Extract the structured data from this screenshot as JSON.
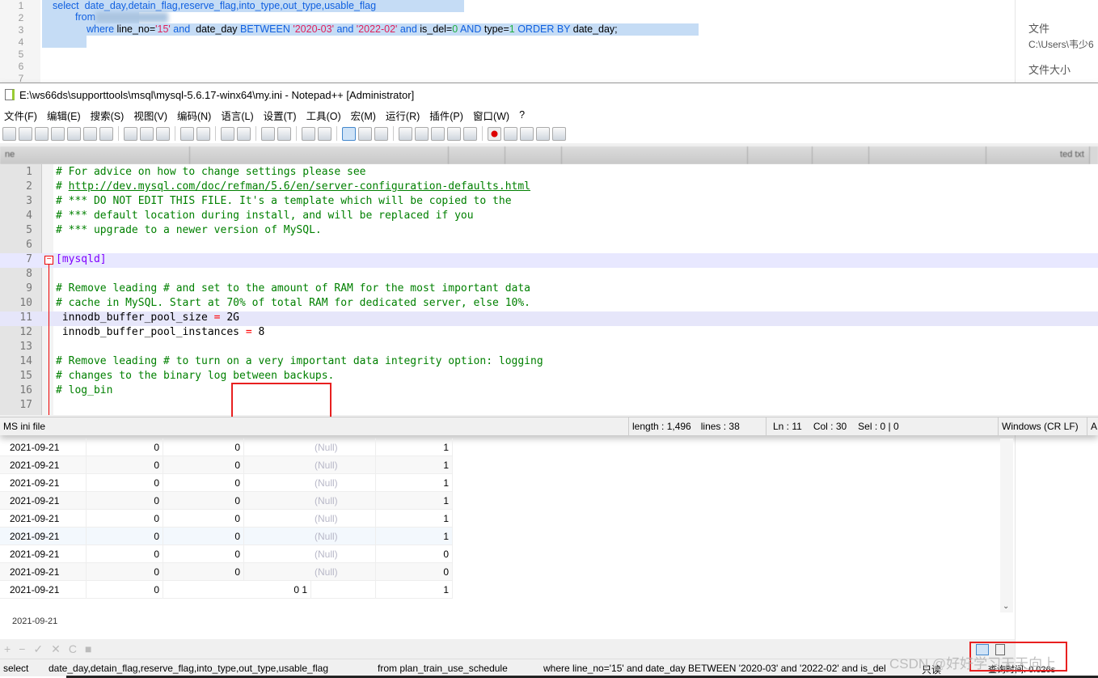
{
  "sql_editor": {
    "lines": [
      "1",
      "2",
      "3",
      "4",
      "5",
      "6",
      "7"
    ],
    "line1": "select  date_day,detain_flag,reserve_flag,into_type,out_type,usable_flag",
    "line2_kw": "from",
    "line3": [
      {
        "t": "where",
        "c": "kw"
      },
      {
        "t": " line_no=",
        "c": ""
      },
      {
        "t": "'15'",
        "c": "str"
      },
      {
        "t": " and ",
        "c": "kw"
      },
      {
        "t": " date_day ",
        "c": ""
      },
      {
        "t": "BETWEEN",
        "c": "kw"
      },
      {
        "t": " ",
        "c": ""
      },
      {
        "t": "'2020-03'",
        "c": "str"
      },
      {
        "t": " and ",
        "c": "kw"
      },
      {
        "t": "'2022-02'",
        "c": "str"
      },
      {
        "t": " and ",
        "c": "kw"
      },
      {
        "t": "is_del=",
        "c": ""
      },
      {
        "t": "0",
        "c": "num"
      },
      {
        "t": " AND ",
        "c": "kw"
      },
      {
        "t": "type=",
        "c": ""
      },
      {
        "t": "1",
        "c": "num"
      },
      {
        "t": " ORDER BY ",
        "c": "kw"
      },
      {
        "t": "date_day;",
        "c": ""
      }
    ]
  },
  "right_panel": {
    "file_label": "文件",
    "file_path": "C:\\Users\\韦少6",
    "size_label": "文件大小"
  },
  "notepad": {
    "title": "E:\\ws66ds\\supporttools\\msql\\mysql-5.6.17-winx64\\my.ini - Notepad++ [Administrator]",
    "menu": [
      "文件(F)",
      "编辑(E)",
      "搜索(S)",
      "视图(V)",
      "编码(N)",
      "语言(L)",
      "设置(T)",
      "工具(O)",
      "宏(M)",
      "运行(R)",
      "插件(P)",
      "窗口(W)",
      "?"
    ],
    "tabs": [
      "ne",
      "",
      "",
      "",
      "",
      "",
      "",
      "",
      "ted txt"
    ],
    "lines": [
      "# For advice on how to change settings please see",
      "# http://dev.mysql.com/doc/refman/5.6/en/server-configuration-defaults.html",
      "# *** DO NOT EDIT THIS FILE. It's a template which will be copied to the",
      "# *** default location during install, and will be replaced if you",
      "# *** upgrade to a newer version of MySQL.",
      "",
      "[mysqld]",
      "",
      "# Remove leading # and set to the amount of RAM for the most important data",
      "# cache in MySQL. Start at 70% of total RAM for dedicated server, else 10%.",
      " innodb_buffer_pool_size = 2G",
      " innodb_buffer_pool_instances = 8",
      "",
      "# Remove leading # to turn on a very important data integrity option: logging",
      "# changes to the binary log between backups.",
      "# log_bin",
      ""
    ],
    "status": {
      "type": "MS ini file",
      "length": "length : 1,496",
      "lines": "lines : 38",
      "ln": "Ln : 11",
      "col": "Col : 30",
      "sel": "Sel : 0 | 0",
      "eol": "Windows (CR LF)",
      "enc": "A"
    },
    "colors": {
      "comment": "#008000",
      "section": "#8000ff",
      "operator": "#ff0000",
      "highlight": "#e82020"
    }
  },
  "grid": {
    "rows": [
      [
        "2021-09-21",
        "0",
        "0",
        "(Null)",
        "1"
      ],
      [
        "2021-09-21",
        "0",
        "0",
        "(Null)",
        "1"
      ],
      [
        "2021-09-21",
        "0",
        "0",
        "(Null)",
        "1"
      ],
      [
        "2021-09-21",
        "0",
        "0",
        "(Null)",
        "1"
      ],
      [
        "2021-09-21",
        "0",
        "0",
        "(Null)",
        "1"
      ],
      [
        "2021-09-21",
        "0",
        "0",
        "(Null)",
        "1"
      ],
      [
        "2021-09-21",
        "0",
        "0",
        "(Null)",
        "0"
      ],
      [
        "2021-09-21",
        "0",
        "0",
        "(Null)",
        "0"
      ],
      [
        "2021-09-21",
        "0",
        "0 1",
        "",
        "1"
      ]
    ]
  },
  "detail_value": "2021-09-21",
  "grid_toolbar": [
    "+",
    "−",
    "✓",
    "✕",
    "C",
    "■"
  ],
  "bottom_status": {
    "select": "select",
    "cols": "date_day,detain_flag,reserve_flag,into_type,out_type,usable_flag",
    "from": "from plan_train_use_schedule",
    "where": "where line_no='15' and  date_day BETWEEN '2020-03' and '2022-02' and is_del",
    "readonly": "只读",
    "time": "查询时间: 0.026s"
  },
  "watermark": "CSDN @好好学习天天向上"
}
